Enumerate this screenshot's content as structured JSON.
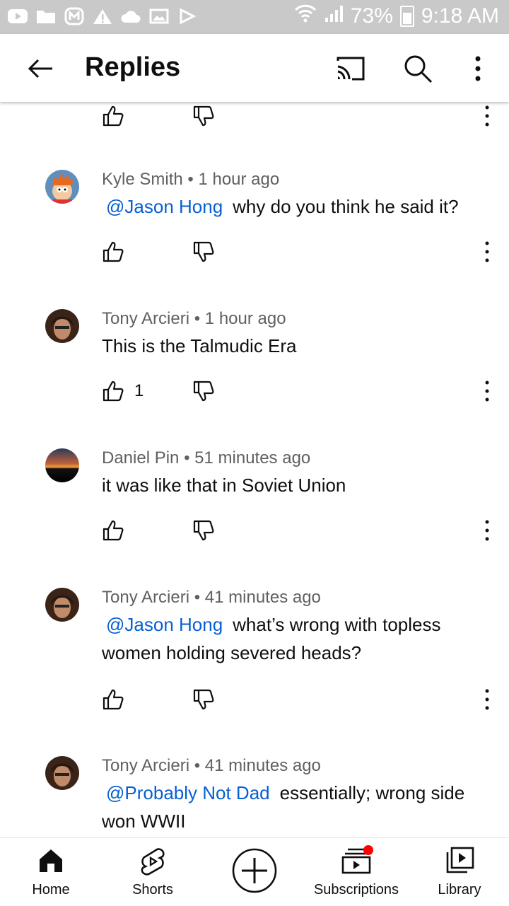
{
  "status_bar": {
    "battery": "73%",
    "time": "9:18 AM"
  },
  "app_bar": {
    "title": "Replies"
  },
  "comments": [
    {
      "author": "Kyle Smith",
      "time": "1 hour ago",
      "mention": "@Jason Hong",
      "text": "why do you think he said it?",
      "likes": ""
    },
    {
      "author": "Tony Arcieri",
      "time": "1 hour ago",
      "mention": "",
      "text": "This is the Talmudic Era",
      "likes": "1"
    },
    {
      "author": "Daniel Pin",
      "time": "51 minutes ago",
      "mention": "",
      "text": "it was like that in Soviet Union",
      "likes": ""
    },
    {
      "author": "Tony Arcieri",
      "time": "41 minutes ago",
      "mention": "@Jason Hong",
      "text": "what’s wrong with topless women holding severed heads?",
      "likes": ""
    },
    {
      "author": "Tony Arcieri",
      "time": "41 minutes ago",
      "mention": "@Probably Not Dad",
      "text": "essentially; wrong side won WWII",
      "likes": ""
    }
  ],
  "meta_separator": "•",
  "bottom_nav": {
    "home": "Home",
    "shorts": "Shorts",
    "subscriptions": "Subscriptions",
    "library": "Library"
  },
  "colors": {
    "mention": "#065fd4",
    "meta": "#606060",
    "notification_dot": "#ff0000",
    "status_bar": "#c9c9c9"
  }
}
